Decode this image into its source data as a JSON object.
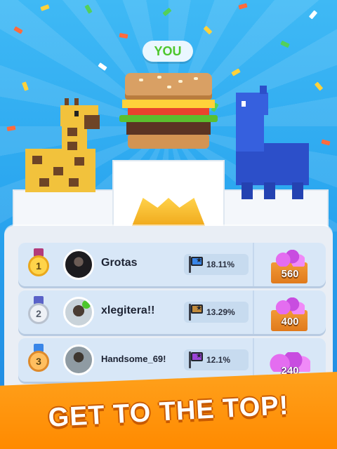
{
  "badge": {
    "you_label": "YOU"
  },
  "leaderboard": {
    "rows": [
      {
        "rank": "1",
        "medal": "gold-medal",
        "name": "Grotas",
        "share": "18.11%",
        "flag_color": "#3a86e8",
        "reward": "560",
        "reward_icon": "gem-box-icon"
      },
      {
        "rank": "2",
        "medal": "silver-medal",
        "name": "xlegitera!!",
        "share": "13.29%",
        "flag_color": "#c28b3c",
        "reward": "400",
        "reward_icon": "gem-box-icon"
      },
      {
        "rank": "3",
        "medal": "bronze-medal",
        "name": "Handsome_69!",
        "share": "12.1%",
        "flag_color": "#9b45d6",
        "reward": "240",
        "reward_icon": "gem-pile-icon"
      }
    ]
  },
  "footer": {
    "cta": "GET TO THE TOP!"
  },
  "colors": {
    "accent": "#ff8a00",
    "sky": "#2aa6ef",
    "you_green": "#4dc72c"
  }
}
